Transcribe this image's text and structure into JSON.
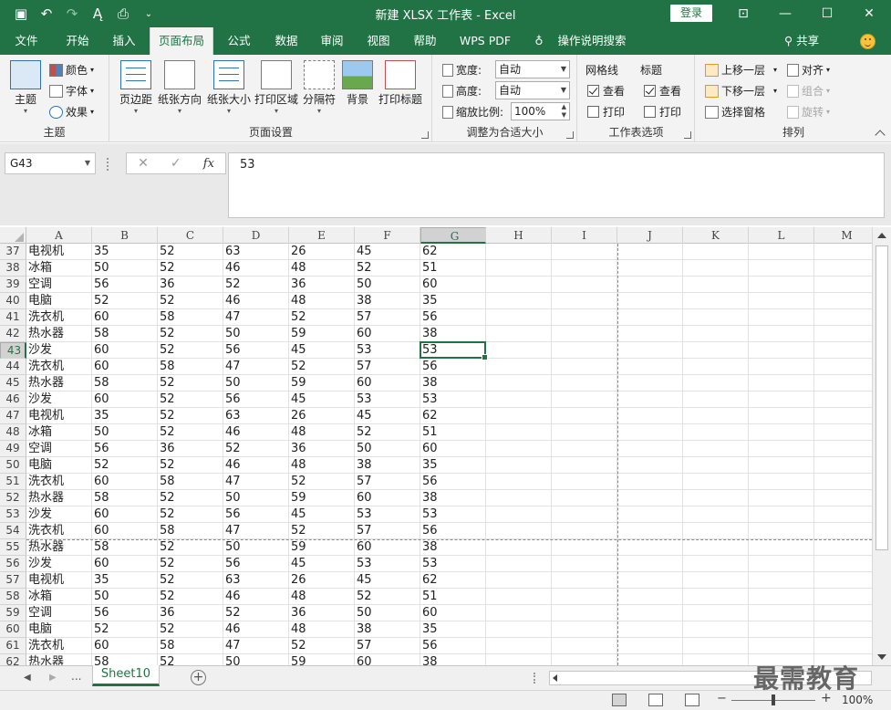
{
  "window": {
    "title": "新建 XLSX 工作表 - Excel",
    "login_label": "登录"
  },
  "tabs": [
    {
      "label": "文件"
    },
    {
      "label": "开始"
    },
    {
      "label": "插入"
    },
    {
      "label": "页面布局"
    },
    {
      "label": "公式"
    },
    {
      "label": "数据"
    },
    {
      "label": "审阅"
    },
    {
      "label": "视图"
    },
    {
      "label": "帮助"
    },
    {
      "label": "WPS PDF"
    },
    {
      "label": "操作说明搜索"
    }
  ],
  "active_tab": "页面布局",
  "share_label": "共享",
  "ribbon": {
    "theme": {
      "group_label": "主题",
      "themes_label": "主题",
      "colors_label": "颜色",
      "fonts_label": "字体",
      "effects_label": "效果"
    },
    "page_setup": {
      "group_label": "页面设置",
      "buttons": [
        "页边距",
        "纸张方向",
        "纸张大小",
        "打印区域",
        "分隔符",
        "背景",
        "打印标题"
      ]
    },
    "scale": {
      "group_label": "调整为合适大小",
      "width_label": "宽度:",
      "width_value": "自动",
      "height_label": "高度:",
      "height_value": "自动",
      "scale_label": "缩放比例:",
      "scale_value": "100%"
    },
    "sheet_options": {
      "group_label": "工作表选项",
      "gridlines_label": "网格线",
      "headings_label": "标题",
      "view_label": "查看",
      "print_label": "打印"
    },
    "arrange": {
      "group_label": "排列",
      "bring_forward": "上移一层",
      "send_backward": "下移一层",
      "selection_pane": "选择窗格",
      "align": "对齐",
      "group": "组合",
      "rotate": "旋转"
    }
  },
  "formula_bar": {
    "name_box": "G43",
    "fx_label": "fx",
    "content": "53"
  },
  "columns": [
    "A",
    "B",
    "C",
    "D",
    "E",
    "F",
    "G",
    "H",
    "I",
    "J",
    "K",
    "L",
    "M"
  ],
  "selected_column": "G",
  "selected_row": "43",
  "rows": [
    {
      "n": "37",
      "cells": [
        "电视机",
        "35",
        "52",
        "63",
        "26",
        "45",
        "62"
      ]
    },
    {
      "n": "38",
      "cells": [
        "冰箱",
        "50",
        "52",
        "46",
        "48",
        "52",
        "51"
      ]
    },
    {
      "n": "39",
      "cells": [
        "空调",
        "56",
        "36",
        "52",
        "36",
        "50",
        "60"
      ]
    },
    {
      "n": "40",
      "cells": [
        "电脑",
        "52",
        "52",
        "46",
        "48",
        "38",
        "35"
      ]
    },
    {
      "n": "41",
      "cells": [
        "洗衣机",
        "60",
        "58",
        "47",
        "52",
        "57",
        "56"
      ]
    },
    {
      "n": "42",
      "cells": [
        "热水器",
        "58",
        "52",
        "50",
        "59",
        "60",
        "38"
      ]
    },
    {
      "n": "43",
      "cells": [
        "沙发",
        "60",
        "52",
        "56",
        "45",
        "53",
        "53"
      ]
    },
    {
      "n": "44",
      "cells": [
        "洗衣机",
        "60",
        "58",
        "47",
        "52",
        "57",
        "56"
      ]
    },
    {
      "n": "45",
      "cells": [
        "热水器",
        "58",
        "52",
        "50",
        "59",
        "60",
        "38"
      ]
    },
    {
      "n": "46",
      "cells": [
        "沙发",
        "60",
        "52",
        "56",
        "45",
        "53",
        "53"
      ]
    },
    {
      "n": "47",
      "cells": [
        "电视机",
        "35",
        "52",
        "63",
        "26",
        "45",
        "62"
      ]
    },
    {
      "n": "48",
      "cells": [
        "冰箱",
        "50",
        "52",
        "46",
        "48",
        "52",
        "51"
      ]
    },
    {
      "n": "49",
      "cells": [
        "空调",
        "56",
        "36",
        "52",
        "36",
        "50",
        "60"
      ]
    },
    {
      "n": "50",
      "cells": [
        "电脑",
        "52",
        "52",
        "46",
        "48",
        "38",
        "35"
      ]
    },
    {
      "n": "51",
      "cells": [
        "洗衣机",
        "60",
        "58",
        "47",
        "52",
        "57",
        "56"
      ]
    },
    {
      "n": "52",
      "cells": [
        "热水器",
        "58",
        "52",
        "50",
        "59",
        "60",
        "38"
      ]
    },
    {
      "n": "53",
      "cells": [
        "沙发",
        "60",
        "52",
        "56",
        "45",
        "53",
        "53"
      ]
    },
    {
      "n": "54",
      "cells": [
        "洗衣机",
        "60",
        "58",
        "47",
        "52",
        "57",
        "56"
      ]
    },
    {
      "n": "55",
      "cells": [
        "热水器",
        "58",
        "52",
        "50",
        "59",
        "60",
        "38"
      ]
    },
    {
      "n": "56",
      "cells": [
        "沙发",
        "60",
        "52",
        "56",
        "45",
        "53",
        "53"
      ]
    },
    {
      "n": "57",
      "cells": [
        "电视机",
        "35",
        "52",
        "63",
        "26",
        "45",
        "62"
      ]
    },
    {
      "n": "58",
      "cells": [
        "冰箱",
        "50",
        "52",
        "46",
        "48",
        "52",
        "51"
      ]
    },
    {
      "n": "59",
      "cells": [
        "空调",
        "56",
        "36",
        "52",
        "36",
        "50",
        "60"
      ]
    },
    {
      "n": "60",
      "cells": [
        "电脑",
        "52",
        "52",
        "46",
        "48",
        "38",
        "35"
      ]
    },
    {
      "n": "61",
      "cells": [
        "洗衣机",
        "60",
        "58",
        "47",
        "52",
        "57",
        "56"
      ]
    },
    {
      "n": "62",
      "cells": [
        "热水器",
        "58",
        "52",
        "50",
        "59",
        "60",
        "38"
      ]
    }
  ],
  "sheet_tabs": {
    "more": "...",
    "active": "Sheet10"
  },
  "status_bar": {
    "zoom": "100%"
  },
  "watermark": "最需教育",
  "colors": {
    "accent": "#217346",
    "selection": "#217346"
  }
}
